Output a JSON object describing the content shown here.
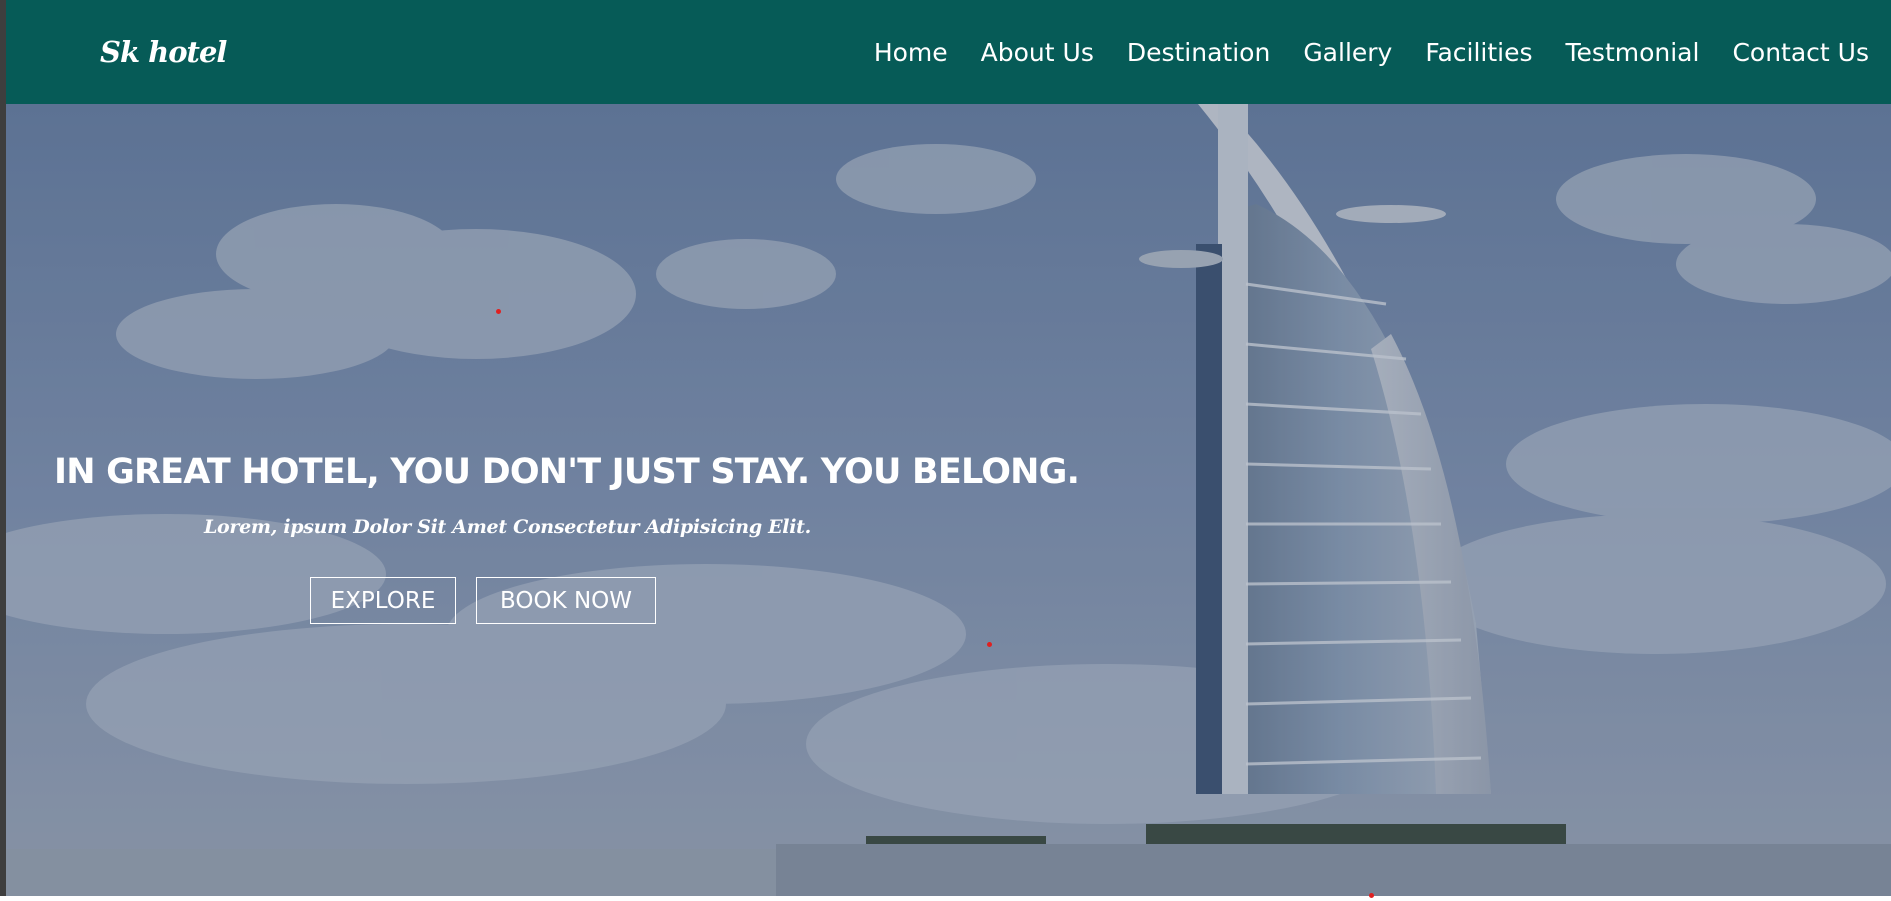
{
  "brand": {
    "logo_text": "Sk hotel"
  },
  "nav": {
    "items": [
      {
        "label": "Home"
      },
      {
        "label": "About Us"
      },
      {
        "label": "Destination"
      },
      {
        "label": "Gallery"
      },
      {
        "label": "Facilities"
      },
      {
        "label": "Testmonial"
      },
      {
        "label": "Contact Us"
      }
    ]
  },
  "hero": {
    "title": "IN GREAT HOTEL, YOU DON'T JUST STAY. YOU BELONG.",
    "subtitle": "Lorem, ipsum Dolor Sit Amet Consectetur Adipisicing Elit.",
    "buttons": {
      "explore_label": "EXPLORE",
      "book_label": "BOOK NOW"
    },
    "background_image": "burj-al-arab-tower-photo"
  },
  "colors": {
    "header_bg": "#065b57",
    "text": "#ffffff",
    "sky": "#8094b3",
    "debug_dot": "#e02020"
  }
}
